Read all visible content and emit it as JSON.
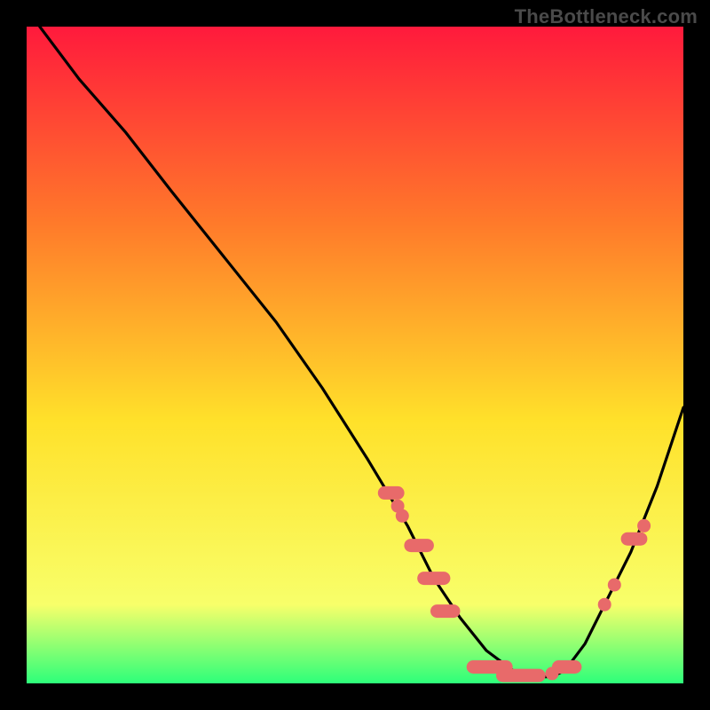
{
  "watermark": "TheBottleneck.com",
  "colors": {
    "bg": "#000000",
    "curve": "#000000",
    "marker": "#e86a6a",
    "grad_top": "#ff1a3c",
    "grad_mid1": "#ff7a2a",
    "grad_mid2": "#ffe12a",
    "grad_mid3": "#f8ff6a",
    "grad_bot": "#2dff7a"
  },
  "chart_data": {
    "type": "line",
    "title": "",
    "xlabel": "",
    "ylabel": "",
    "xlim": [
      0,
      100
    ],
    "ylim": [
      0,
      100
    ],
    "grid": false,
    "legend": false,
    "series": [
      {
        "name": "curve",
        "x": [
          2,
          8,
          15,
          22,
          30,
          38,
          45,
          52,
          58,
          62,
          66,
          70,
          74,
          78,
          80,
          82,
          85,
          88,
          92,
          96,
          100
        ],
        "y": [
          100,
          92,
          84,
          75,
          65,
          55,
          45,
          34,
          24,
          16,
          10,
          5,
          2,
          1,
          1,
          2,
          6,
          12,
          20,
          30,
          42
        ]
      }
    ],
    "markers": [
      {
        "type": "capsule",
        "x1": 54.5,
        "x2": 56.5,
        "y": 29
      },
      {
        "type": "dot",
        "x": 56.5,
        "y": 27
      },
      {
        "type": "dot",
        "x": 57.2,
        "y": 25.5
      },
      {
        "type": "capsule",
        "x1": 58.5,
        "x2": 61.0,
        "y": 21
      },
      {
        "type": "capsule",
        "x1": 60.5,
        "x2": 63.5,
        "y": 16
      },
      {
        "type": "capsule",
        "x1": 62.5,
        "x2": 65.0,
        "y": 11
      },
      {
        "type": "capsule",
        "x1": 68.0,
        "x2": 73.0,
        "y": 2.5
      },
      {
        "type": "capsule",
        "x1": 72.5,
        "x2": 78.0,
        "y": 1.2
      },
      {
        "type": "dot",
        "x": 80.0,
        "y": 1.5
      },
      {
        "type": "capsule",
        "x1": 81.0,
        "x2": 83.5,
        "y": 2.5
      },
      {
        "type": "dot",
        "x": 88.0,
        "y": 12
      },
      {
        "type": "dot",
        "x": 89.5,
        "y": 15
      },
      {
        "type": "capsule",
        "x1": 91.5,
        "x2": 93.5,
        "y": 22
      },
      {
        "type": "dot",
        "x": 94.0,
        "y": 24
      }
    ]
  }
}
